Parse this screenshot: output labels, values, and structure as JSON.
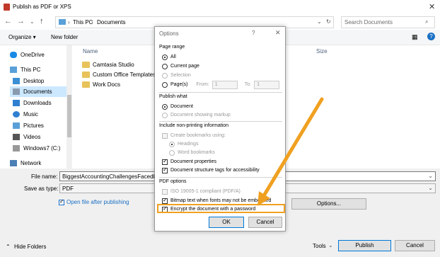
{
  "window": {
    "title": "Publish as PDF or XPS"
  },
  "address": {
    "path": [
      "This PC",
      "Documents"
    ],
    "search_placeholder": "Search Documents"
  },
  "toolbar": {
    "organize": "Organize ▾",
    "new_folder": "New folder",
    "help": "?"
  },
  "nav": {
    "items": [
      {
        "label": "OneDrive"
      },
      {
        "label": "This PC"
      },
      {
        "label": "Desktop"
      },
      {
        "label": "Documents"
      },
      {
        "label": "Downloads"
      },
      {
        "label": "Music"
      },
      {
        "label": "Pictures"
      },
      {
        "label": "Videos"
      },
      {
        "label": "Windows7 (C:)"
      },
      {
        "label": "Network"
      }
    ]
  },
  "files": {
    "columns": {
      "name": "Name",
      "size": "Size"
    },
    "items": [
      {
        "label": "Camtasia Studio"
      },
      {
        "label": "Custom Office Templates"
      },
      {
        "label": "Work Docs"
      }
    ]
  },
  "bottom": {
    "file_name_label": "File name:",
    "file_name_value": "BiggestAccountingChallengesFacedby",
    "save_type_label": "Save as type:",
    "save_type_value": "PDF",
    "open_after": "Open file after publishing",
    "options_button": "Options...",
    "hide_folders": "Hide Folders",
    "tools": "Tools",
    "publish": "Publish",
    "cancel": "Cancel"
  },
  "dialog": {
    "title": "Options",
    "help": "?",
    "close": "✕",
    "page_range": {
      "header": "Page range",
      "all": "All",
      "current": "Current page",
      "selection": "Selection",
      "pages": "Page(s)",
      "from_label": "From:",
      "from_value": "1",
      "to_label": "To:",
      "to_value": "1"
    },
    "publish_what": {
      "header": "Publish what",
      "document": "Document",
      "markup": "Document showing markup"
    },
    "non_printing": {
      "header": "Include non-printing information",
      "create_bookmarks": "Create bookmarks using:",
      "headings": "Headings",
      "word_bookmarks": "Word bookmarks",
      "doc_properties": "Document properties",
      "structure_tags": "Document structure tags for accessibility"
    },
    "pdf_options": {
      "header": "PDF options",
      "iso": "ISO 19005-1 compliant (PDF/A)",
      "bitmap": "Bitmap text when fonts may not be embedded",
      "encrypt": "Encrypt the document with a password"
    },
    "ok": "OK",
    "cancel": "Cancel"
  },
  "colors": {
    "highlight": "#f0a020",
    "folder": "#e8c35b",
    "selection": "#cce8ff"
  }
}
